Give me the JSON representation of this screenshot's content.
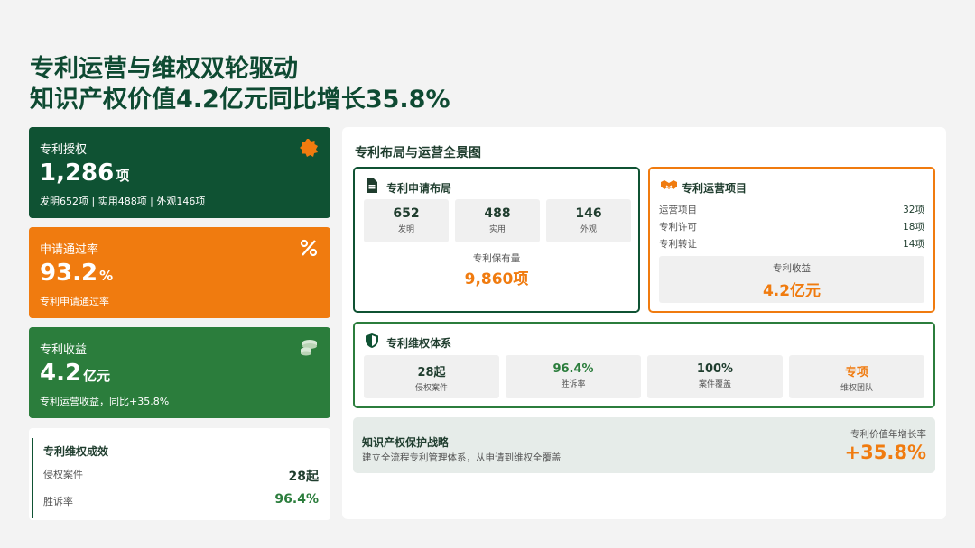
{
  "header": {
    "line1": "专利运营与维权双轮驱动",
    "line2": "知识产权价值4.2亿元同比增长35.8%"
  },
  "cards": {
    "grant": {
      "label": "专利授权",
      "value": "1,286",
      "unit": "项",
      "sub": "发明652项 | 实用488项 | 外观146项",
      "icon": "badge-icon"
    },
    "pass_rate": {
      "label": "申请通过率",
      "value": "93.2",
      "unit": "%",
      "sub": "专利申请通过率",
      "icon": "percent-icon"
    },
    "revenue": {
      "label": "专利收益",
      "value": "4.2",
      "unit": "亿元",
      "sub": "专利运营收益，同比+35.8%",
      "icon": "coins-icon"
    }
  },
  "rights_result": {
    "title": "专利维权成效",
    "rows": [
      {
        "label": "侵权案件",
        "value": "28起"
      },
      {
        "label": "胜诉率",
        "value": "96.4%"
      }
    ]
  },
  "panel": {
    "title": "专利布局与运营全景图",
    "layout": {
      "title": "专利申请布局",
      "tiles": [
        {
          "value": "652",
          "label": "发明"
        },
        {
          "value": "488",
          "label": "实用"
        },
        {
          "value": "146",
          "label": "外观"
        }
      ],
      "hold_label": "专利保有量",
      "hold_value": "9,860项"
    },
    "ops": {
      "title": "专利运营项目",
      "rows": [
        {
          "label": "运营项目",
          "value": "32项"
        },
        {
          "label": "专利许可",
          "value": "18项"
        },
        {
          "label": "专利转让",
          "value": "14项"
        }
      ],
      "income_label": "专利收益",
      "income_value": "4.2亿元"
    },
    "rights": {
      "title": "专利维权体系",
      "tiles": [
        {
          "value": "28起",
          "label": "侵权案件"
        },
        {
          "value": "96.4%",
          "label": "胜诉率"
        },
        {
          "value": "100%",
          "label": "案件覆盖"
        },
        {
          "value": "专项",
          "label": "维权团队"
        }
      ]
    },
    "strategy": {
      "title": "知识产权保护战略",
      "desc": "建立全流程专利管理体系，从申请到维权全覆盖",
      "growth_label": "专利价值年增长率",
      "growth_value": "+35.8%"
    }
  },
  "colors": {
    "dark_green": "#0f5233",
    "orange": "#f07b0f",
    "green": "#2b7d3c"
  }
}
